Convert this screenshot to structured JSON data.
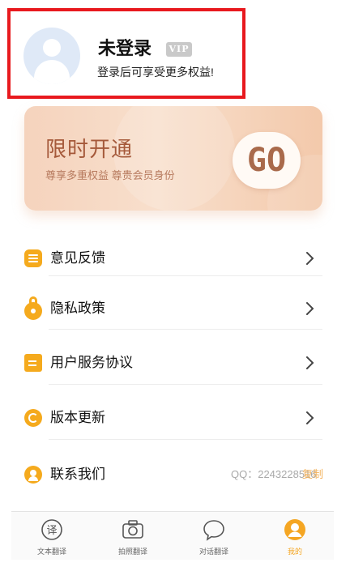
{
  "profile": {
    "name": "未登录",
    "vip_badge": "VIP",
    "subtitle": "登录后可享受更多权益!"
  },
  "banner": {
    "title": "限时开通",
    "subtitle": "尊享多重权益 尊贵会员身份",
    "go_label": "GO"
  },
  "menu": {
    "items": [
      {
        "label": "意见反馈",
        "icon": "feedback-icon"
      },
      {
        "label": "隐私政策",
        "icon": "lock-icon"
      },
      {
        "label": "用户服务协议",
        "icon": "document-icon"
      },
      {
        "label": "版本更新",
        "icon": "update-icon"
      },
      {
        "label": "联系我们",
        "icon": "contact-icon"
      }
    ],
    "contact_qq": "QQ：2243228516",
    "copy_label": "复制"
  },
  "tabs": [
    {
      "label": "文本翻译",
      "icon": "text-translate-icon"
    },
    {
      "label": "拍照翻译",
      "icon": "camera-icon"
    },
    {
      "label": "对话翻译",
      "icon": "chat-icon"
    },
    {
      "label": "我的",
      "icon": "profile-icon",
      "active": true
    }
  ],
  "colors": {
    "accent": "#f5aa1d",
    "highlight_border": "#e8191e",
    "banner_text": "#a5593a",
    "copy_link": "#f3b25c"
  }
}
